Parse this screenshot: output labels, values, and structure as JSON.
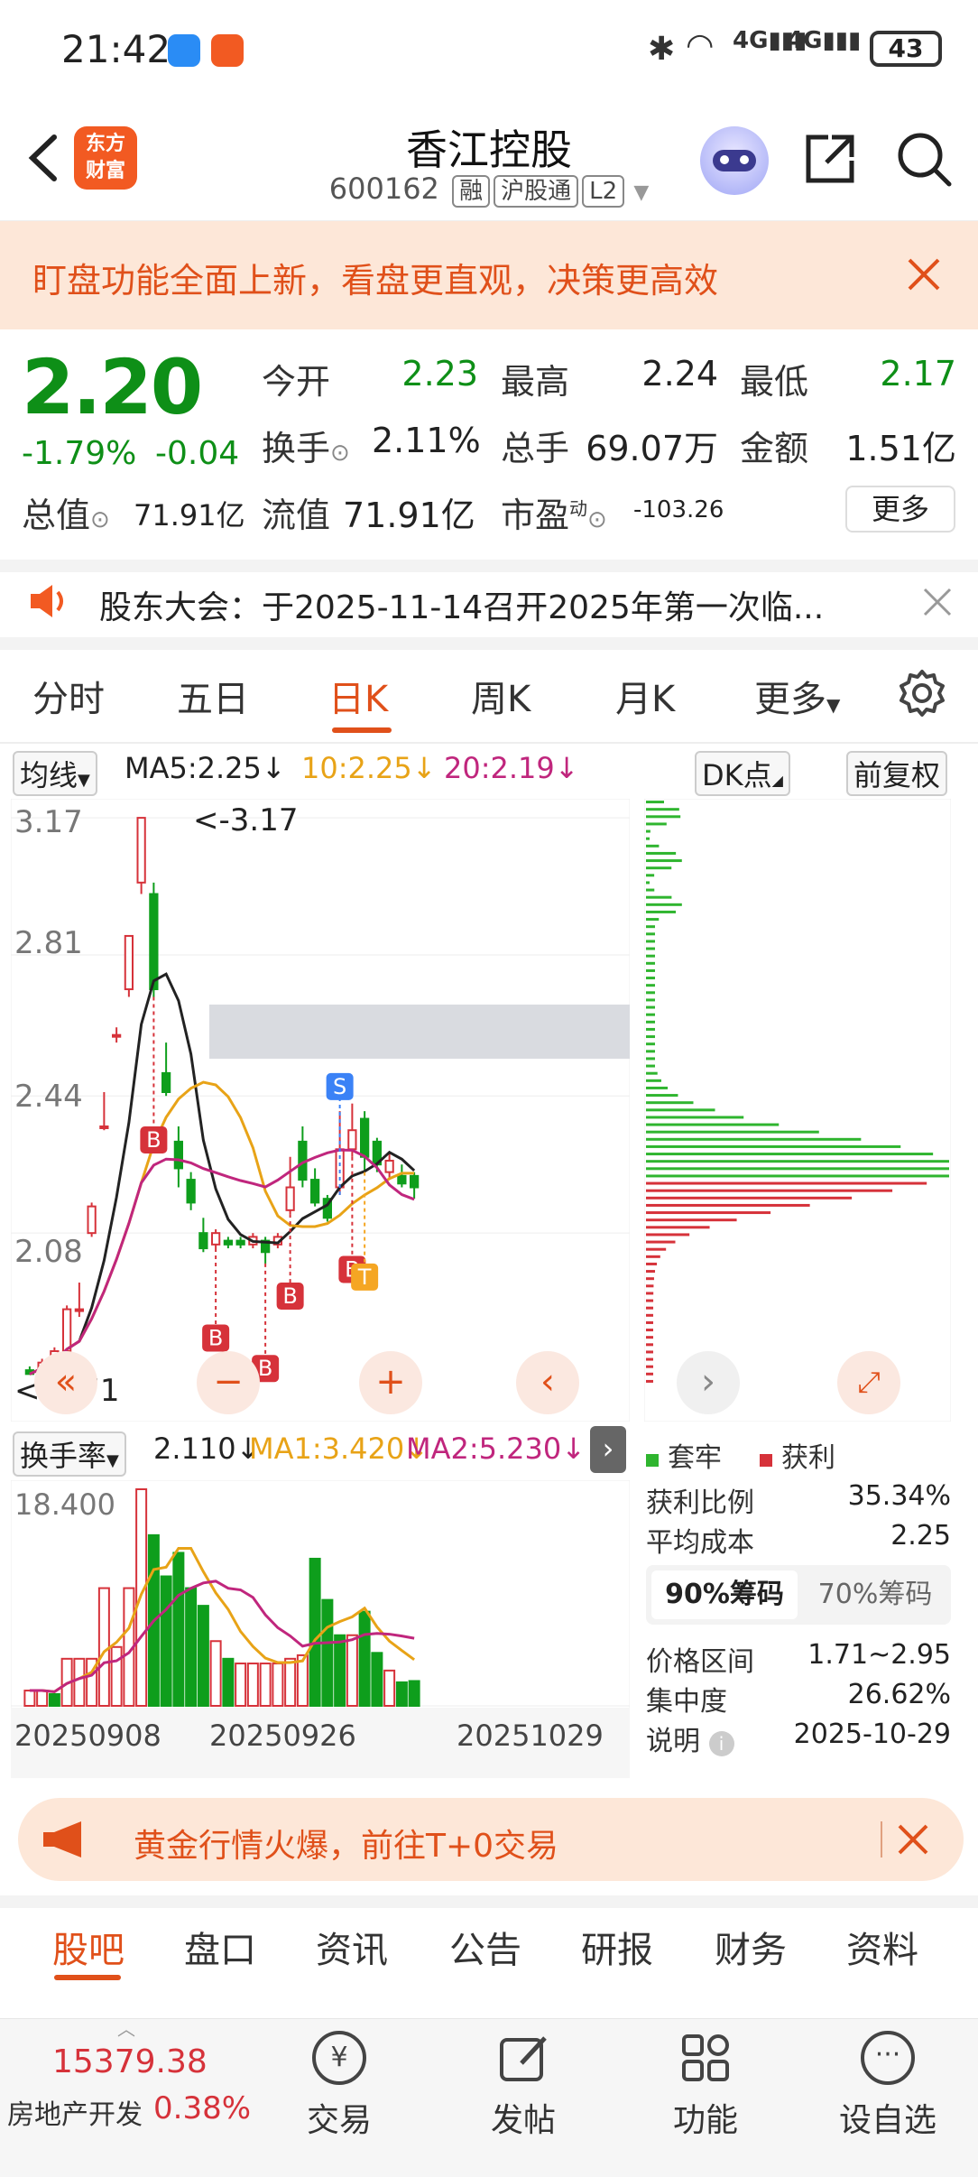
{
  "status_bar": {
    "time": "21:42",
    "battery": "43",
    "network": "4G"
  },
  "header": {
    "logo_text_1": "东方",
    "logo_text_2": "财富",
    "stock_name": "香江控股",
    "stock_code": "600162",
    "tags": [
      "融",
      "沪股通",
      "L2"
    ]
  },
  "banner": {
    "text": "盯盘功能全面上新，看盘更直观，决策更高效"
  },
  "quote": {
    "price": "2.20",
    "change_pct": "-1.79%",
    "change": "-0.04",
    "open_label": "今开",
    "open": "2.23",
    "high_label": "最高",
    "high": "2.24",
    "low_label": "最低",
    "low": "2.17",
    "turnover_label": "换手",
    "turnover": "2.11%",
    "volume_label": "总手",
    "volume": "69.07万",
    "amount_label": "金额",
    "amount": "1.51亿",
    "total_cap_label": "总值",
    "total_cap": "71.91亿",
    "float_cap_label": "流值",
    "float_cap": "71.91亿",
    "pe_label": "市盈",
    "pe_sup": "动",
    "pe": "-103.26",
    "more_label": "更多"
  },
  "notice": {
    "text": "股东大会：于2025-11-14召开2025年第一次临..."
  },
  "kline_tabs": [
    "分时",
    "五日",
    "日K",
    "周K",
    "月K",
    "更多"
  ],
  "active_tab": "日K",
  "ma_bar": {
    "indicator": "均线",
    "ma5": "MA5:2.25↓",
    "ma10": "10:2.25↓",
    "ma20": "20:2.19↓",
    "dk_label": "DK点",
    "adjust_label": "前复权",
    "ma5_color": "#222222",
    "ma10_color": "#e8a317",
    "ma20_color": "#c0267d"
  },
  "chart_data": [
    {
      "type": "candlestick",
      "y_ticks": [
        "3.17",
        "2.81",
        "2.44",
        "2.08"
      ],
      "ylim": [
        1.68,
        3.22
      ],
      "max_label": "<-3.17",
      "min_label": "<-1.71",
      "signal_labels": [
        "B",
        "B",
        "B",
        "B",
        "B",
        "S",
        "T"
      ],
      "candles": [
        {
          "o": 1.72,
          "c": 1.71,
          "h": 1.73,
          "l": 1.71
        },
        {
          "o": 1.71,
          "c": 1.74,
          "h": 1.75,
          "l": 1.71
        },
        {
          "o": 1.74,
          "c": 1.77,
          "h": 1.78,
          "l": 1.73
        },
        {
          "o": 1.77,
          "c": 1.88,
          "h": 1.89,
          "l": 1.77
        },
        {
          "o": 1.88,
          "c": 1.88,
          "h": 1.95,
          "l": 1.86
        },
        {
          "o": 2.08,
          "c": 2.15,
          "h": 2.16,
          "l": 2.07
        },
        {
          "o": 2.36,
          "c": 2.36,
          "h": 2.45,
          "l": 2.35
        },
        {
          "o": 2.6,
          "c": 2.6,
          "h": 2.62,
          "l": 2.58
        },
        {
          "o": 2.72,
          "c": 2.86,
          "h": 2.86,
          "l": 2.7
        },
        {
          "o": 3.0,
          "c": 3.17,
          "h": 3.17,
          "l": 2.97
        },
        {
          "o": 2.97,
          "c": 2.72,
          "h": 3.0,
          "l": 2.7
        },
        {
          "o": 2.5,
          "c": 2.45,
          "h": 2.58,
          "l": 2.44
        },
        {
          "o": 2.32,
          "c": 2.25,
          "h": 2.36,
          "l": 2.2
        },
        {
          "o": 2.22,
          "c": 2.16,
          "h": 2.24,
          "l": 2.14
        },
        {
          "o": 2.08,
          "c": 2.04,
          "h": 2.12,
          "l": 2.03
        },
        {
          "o": 2.05,
          "c": 2.08,
          "h": 2.09,
          "l": 2.04
        },
        {
          "o": 2.06,
          "c": 2.05,
          "h": 2.07,
          "l": 2.04
        },
        {
          "o": 2.06,
          "c": 2.05,
          "h": 2.07,
          "l": 2.04
        },
        {
          "o": 2.05,
          "c": 2.07,
          "h": 2.08,
          "l": 2.04
        },
        {
          "o": 2.06,
          "c": 2.03,
          "h": 2.07,
          "l": 2.0
        },
        {
          "o": 2.05,
          "c": 2.07,
          "h": 2.08,
          "l": 2.04
        },
        {
          "o": 2.14,
          "c": 2.2,
          "h": 2.28,
          "l": 2.13
        },
        {
          "o": 2.32,
          "c": 2.22,
          "h": 2.36,
          "l": 2.2
        },
        {
          "o": 2.22,
          "c": 2.16,
          "h": 2.25,
          "l": 2.15
        },
        {
          "o": 2.17,
          "c": 2.12,
          "h": 2.18,
          "l": 2.11
        },
        {
          "o": 2.2,
          "c": 2.3,
          "h": 2.4,
          "l": 2.18
        },
        {
          "o": 2.3,
          "c": 2.35,
          "h": 2.42,
          "l": 2.28
        },
        {
          "o": 2.38,
          "c": 2.28,
          "h": 2.4,
          "l": 2.24
        },
        {
          "o": 2.32,
          "c": 2.26,
          "h": 2.33,
          "l": 2.24
        },
        {
          "o": 2.24,
          "c": 2.27,
          "h": 2.29,
          "l": 2.22
        },
        {
          "o": 2.23,
          "c": 2.21,
          "h": 2.26,
          "l": 2.2
        },
        {
          "o": 2.23,
          "c": 2.2,
          "h": 2.24,
          "l": 2.17
        }
      ]
    },
    {
      "type": "bar",
      "title": "换手率",
      "current": "2.110↓",
      "ma1": "MA1:3.420↓",
      "ma2": "MA2:5.230↓",
      "y_max_label": "18.400",
      "x_tick_labels": [
        "20250908",
        "20250926",
        "20251029"
      ],
      "values": [
        1.3,
        1.3,
        1.0,
        4.0,
        4.0,
        4.0,
        10.0,
        5.0,
        10.0,
        18.4,
        14.5,
        11.0,
        13.0,
        10.0,
        8.5,
        5.5,
        4.0,
        3.6,
        3.6,
        3.6,
        3.6,
        4.0,
        4.3,
        12.5,
        9.0,
        6.0,
        6.0,
        8.0,
        4.5,
        3.0,
        2.0,
        2.11
      ],
      "up": [
        false,
        false,
        true,
        false,
        false,
        false,
        false,
        false,
        false,
        false,
        true,
        true,
        true,
        true,
        true,
        false,
        true,
        false,
        false,
        false,
        false,
        false,
        false,
        true,
        true,
        true,
        false,
        true,
        true,
        false,
        true,
        true
      ]
    }
  ],
  "chip": {
    "legend_hold": "套牢",
    "legend_profit": "获利",
    "profit_ratio_label": "获利比例",
    "profit_ratio": "35.34%",
    "avg_cost_label": "平均成本",
    "avg_cost": "2.25",
    "tab_90": "90%筹码",
    "tab_70": "70%筹码",
    "range_label": "价格区间",
    "range": "1.71~2.95",
    "concentration_label": "集中度",
    "concentration": "26.62%",
    "note_label": "说明",
    "date": "2025-10-29"
  },
  "indicator_label": "换手率",
  "promo": {
    "text": "黄金行情火爆，前往T+0交易"
  },
  "bottom_tabs": [
    "股吧",
    "盘口",
    "资讯",
    "公告",
    "研报",
    "财务",
    "资料"
  ],
  "footer": {
    "index_value": "15379.38",
    "index_name": "房地产开发",
    "index_change": "0.38%",
    "items": [
      "交易",
      "发帖",
      "功能",
      "设自选"
    ]
  },
  "colors": {
    "up": "#d6323a",
    "down": "#0e9e1c",
    "accent": "#e0501a"
  }
}
